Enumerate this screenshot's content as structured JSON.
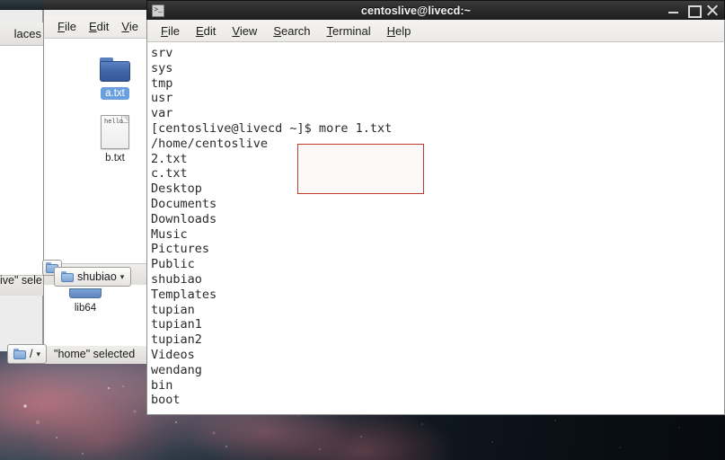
{
  "desktop": {
    "wallpaper_name": "galaxy-nebula-wallpaper",
    "colors": {
      "dark": "#0a1016",
      "slate": "#3c4854",
      "nebula_pink": "#e07a86"
    }
  },
  "places_window": {
    "sidebar_header": "laces",
    "status_text": "ive\" sele"
  },
  "file_manager": {
    "menu": [
      {
        "label": "File",
        "mnemonic": "F"
      },
      {
        "label": "Edit",
        "mnemonic": "E"
      },
      {
        "label": "Vie",
        "mnemonic": "V"
      }
    ],
    "toolbar_icon": "folder-icon",
    "items": [
      {
        "name": "a.txt",
        "icon": "folder-icon",
        "selected": true
      },
      {
        "name": "b.txt",
        "icon": "document-icon",
        "doc_text": "hello",
        "selected": false
      }
    ],
    "lower_item": {
      "name": "lib64",
      "icon": "folder-icon"
    },
    "breadcrumb_shubiao": {
      "label": "shubiao",
      "icon": "folder-icon",
      "chevron": "▾"
    },
    "bottom_breadcrumb": {
      "label": "/",
      "icon": "folder-icon",
      "chevron": "▾"
    },
    "bottom_status": "\"home\" selected"
  },
  "terminal": {
    "title": "centoslive@livecd:~",
    "title_icon": "terminal-icon",
    "window_buttons": {
      "minimize": "minimize-icon",
      "maximize": "maximize-icon",
      "close": "close-icon"
    },
    "menu": [
      {
        "label": "File",
        "mnemonic": "F"
      },
      {
        "label": "Edit",
        "mnemonic": "E"
      },
      {
        "label": "View",
        "mnemonic": "V"
      },
      {
        "label": "Search",
        "mnemonic": "S"
      },
      {
        "label": "Terminal",
        "mnemonic": "T"
      },
      {
        "label": "Help",
        "mnemonic": "H"
      }
    ],
    "lines": [
      "srv",
      "sys",
      "tmp",
      "usr",
      "var",
      "[centoslive@livecd ~]$ more 1.txt",
      "/home/centoslive",
      "2.txt",
      "c.txt",
      "Desktop",
      "Documents",
      "Downloads",
      "Music",
      "Pictures",
      "Public",
      "shubiao",
      "Templates",
      "tupian",
      "tupian1",
      "tupian2",
      "Videos",
      "wendang",
      "bin",
      "boot"
    ],
    "annotation": {
      "shape": "rectangle",
      "color": "#c0392b",
      "highlights": "$ more 1.txt"
    }
  }
}
